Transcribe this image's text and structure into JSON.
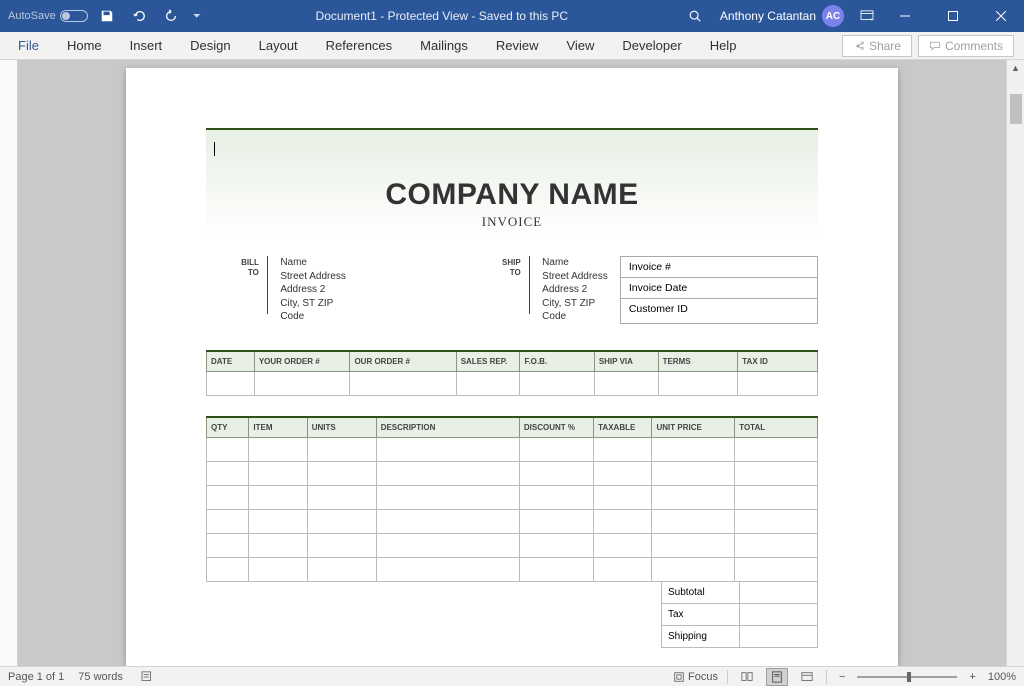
{
  "titlebar": {
    "autosave": "AutoSave",
    "autosave_state": "Off",
    "title": "Document1  -  Protected View  -  Saved to this PC",
    "user": "Anthony Catantan",
    "user_initials": "AC"
  },
  "ribbon": {
    "tabs": [
      "File",
      "Home",
      "Insert",
      "Design",
      "Layout",
      "References",
      "Mailings",
      "Review",
      "View",
      "Developer",
      "Help"
    ],
    "share": "Share",
    "comments": "Comments"
  },
  "invoice": {
    "company": "COMPANY NAME",
    "subtitle": "INVOICE",
    "bill_label_1": "BILL",
    "bill_label_2": "TO",
    "ship_label_1": "SHIP",
    "ship_label_2": "TO",
    "addr": {
      "name": "Name",
      "street": "Street Address",
      "addr2": "Address 2",
      "city": "City, ST  ZIP Code"
    },
    "meta": [
      "Invoice #",
      "Invoice Date",
      "Customer ID"
    ],
    "order_headers": [
      "DATE",
      "YOUR ORDER #",
      "OUR ORDER #",
      "SALES REP.",
      "F.O.B.",
      "SHIP VIA",
      "TERMS",
      "TAX ID"
    ],
    "item_headers": [
      "QTY",
      "ITEM",
      "UNITS",
      "DESCRIPTION",
      "DISCOUNT %",
      "TAXABLE",
      "UNIT PRICE",
      "TOTAL"
    ],
    "totals": [
      "Subtotal",
      "Tax",
      "Shipping"
    ]
  },
  "statusbar": {
    "page": "Page 1 of 1",
    "words": "75 words",
    "focus": "Focus",
    "zoom": "100%"
  }
}
